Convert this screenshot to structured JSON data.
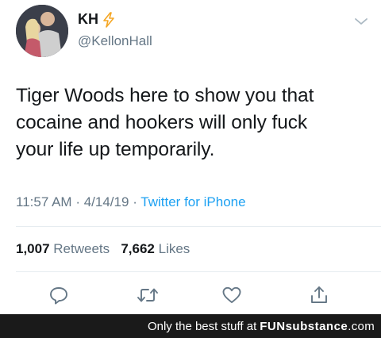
{
  "tweet": {
    "author": {
      "display_name": "KH",
      "handle": "@KellonHall",
      "name_emoji": "lightning-bolt-icon"
    },
    "text_lines": [
      "Tiger Woods here to show you that",
      "cocaine and hookers will only fuck",
      "your life up temporarily."
    ],
    "time": "11:57 AM",
    "separator": "·",
    "date": "4/14/19",
    "source": "Twitter for iPhone",
    "retweets_count": "1,007",
    "retweets_label": "Retweets",
    "likes_count": "7,662",
    "likes_label": "Likes",
    "actions": [
      "reply-icon",
      "retweet-icon",
      "like-icon",
      "share-icon"
    ]
  },
  "footer": {
    "tagline": "Only the best stuff at",
    "brand_part1": "FUN",
    "brand_part2": "substance",
    "brand_part3": ".com"
  },
  "colors": {
    "text": "#14171a",
    "secondary": "#657786",
    "link": "#1da1f2",
    "bolt": "#f5a623",
    "footer_bg": "#1a1a1a"
  }
}
